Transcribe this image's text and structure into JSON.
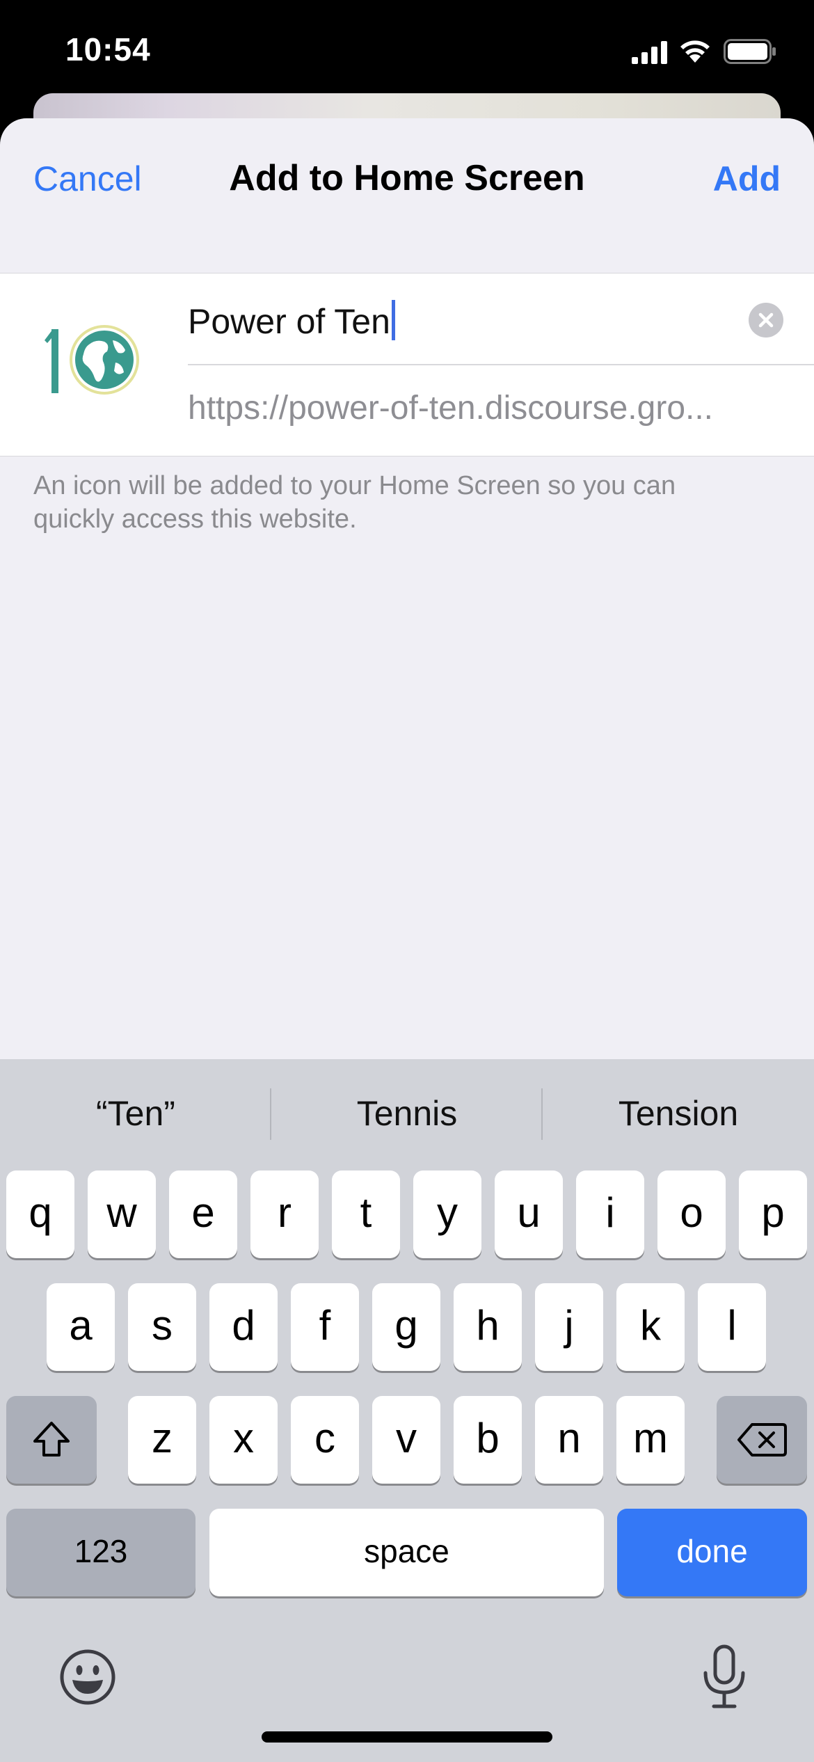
{
  "status_bar": {
    "time": "10:54"
  },
  "sheet": {
    "cancel_label": "Cancel",
    "title": "Add to Home Screen",
    "add_label": "Add",
    "name_value": "Power of Ten",
    "url_text": "https://power-of-ten.discourse.gro...",
    "hint_text": "An icon will be added to your Home Screen so you can quickly access this website."
  },
  "keyboard": {
    "predictions": [
      "“Ten”",
      "Tennis",
      "Tension"
    ],
    "row1": [
      "q",
      "w",
      "e",
      "r",
      "t",
      "y",
      "u",
      "i",
      "o",
      "p"
    ],
    "row2": [
      "a",
      "s",
      "d",
      "f",
      "g",
      "h",
      "j",
      "k",
      "l"
    ],
    "row3": [
      "z",
      "x",
      "c",
      "v",
      "b",
      "n",
      "m"
    ],
    "numbers_label": "123",
    "space_label": "space",
    "done_label": "done"
  },
  "colors": {
    "accent": "#3478f6",
    "sheet_bg": "#f0eff5",
    "keyboard_bg": "#d1d3d9",
    "icon_green": "#3a9a8e"
  },
  "icons": [
    "cellular-signal-icon",
    "wifi-icon",
    "battery-icon",
    "clear-text-icon",
    "globe-icon",
    "shift-icon",
    "backspace-icon",
    "emoji-icon",
    "microphone-icon"
  ]
}
